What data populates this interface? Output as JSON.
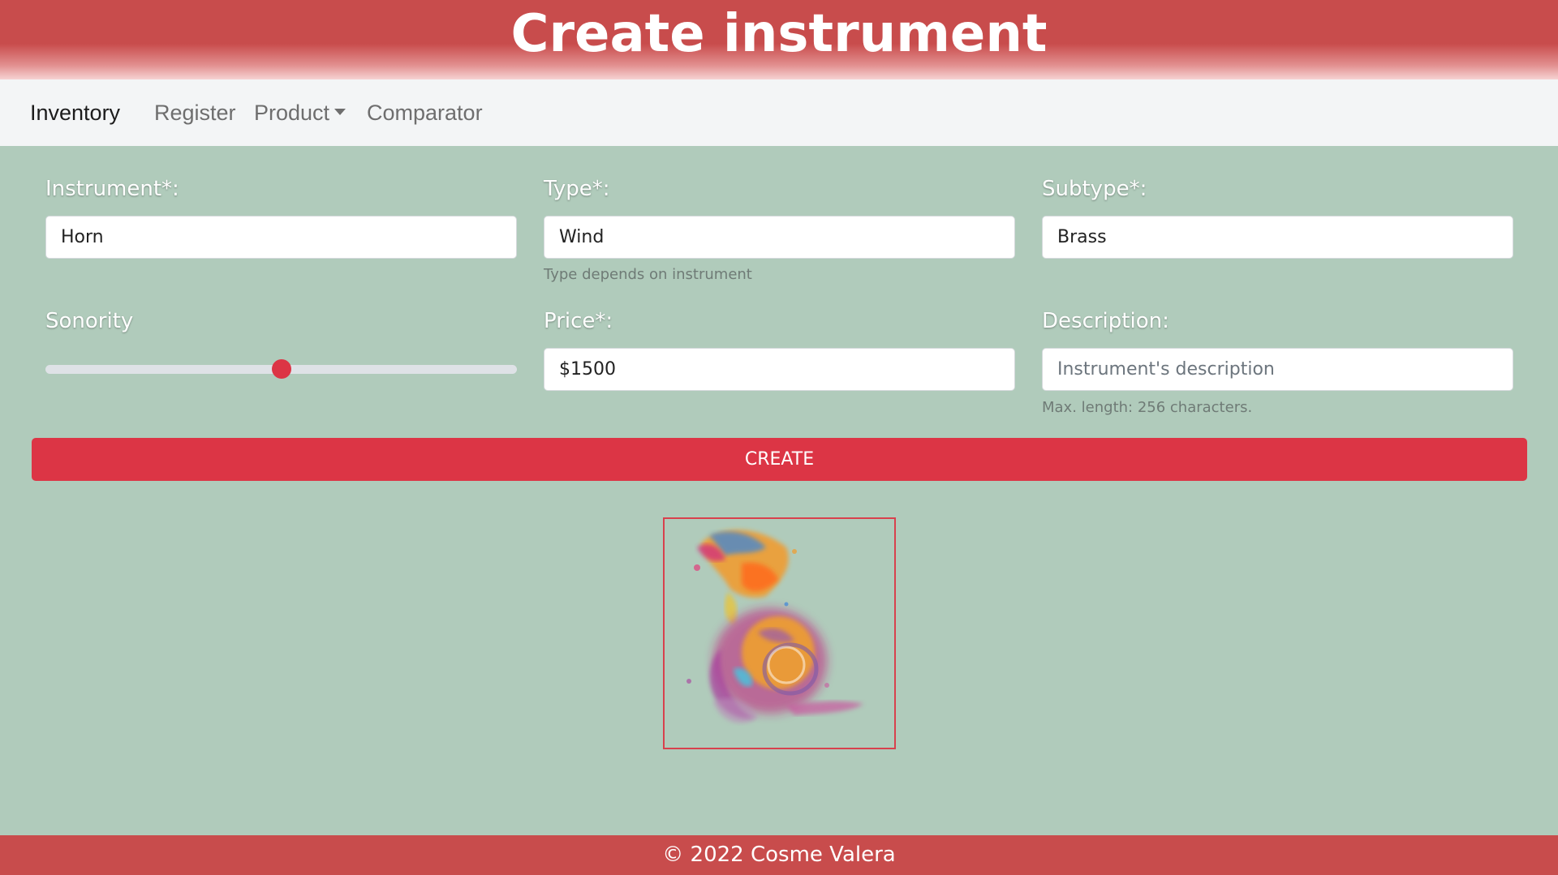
{
  "header": {
    "title": "Create instrument"
  },
  "nav": {
    "brand": "Inventory",
    "items": [
      {
        "label": "Register"
      },
      {
        "label": "Product"
      },
      {
        "label": "Comparator"
      }
    ]
  },
  "form": {
    "instrument": {
      "label": "Instrument*:",
      "value": "Horn"
    },
    "type": {
      "label": "Type*:",
      "value": "Wind",
      "help": "Type depends on instrument"
    },
    "subtype": {
      "label": "Subtype*:",
      "value": "Brass"
    },
    "sonority": {
      "label": "Sonority",
      "level_fraction": 0.5
    },
    "price": {
      "label": "Price*:",
      "value": "$1500"
    },
    "description": {
      "label": "Description:",
      "value": "",
      "placeholder": "Instrument's description",
      "help": "Max. length: 256 characters."
    },
    "submit_label": "CREATE"
  },
  "preview": {
    "icon": "french-horn-watercolor-image"
  },
  "footer": {
    "text": "© 2022 Cosme Valera"
  },
  "colors": {
    "background": "#b0cbbb",
    "header": "#c84c4c",
    "accent": "#dc3545",
    "navbar": "#f3f5f6"
  }
}
